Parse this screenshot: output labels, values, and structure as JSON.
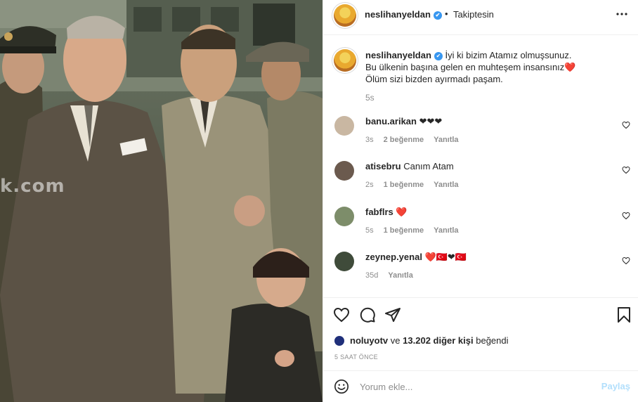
{
  "post": {
    "author": "neslihanyeldan",
    "verified_mark": "✔",
    "follow_separator": "•",
    "follow_status": "Takiptesin",
    "caption": {
      "username": "neslihanyeldan",
      "line1": "İyi ki bizim Atamız olmuşsunuz.",
      "line2": "Bu ülkenin başına gelen en muhteşem insansınız❤️",
      "line3": "Ölüm sizi bizden ayırmadı paşam.",
      "age": "5s"
    },
    "photo_watermark": "k.com",
    "comments": [
      {
        "username": "banu.arikan",
        "text": "❤❤❤",
        "age": "3s",
        "likes": "2 beğenme",
        "reply": "Yanıtla",
        "avatar_color": "#c9b7a2"
      },
      {
        "username": "atisebru",
        "text": "Canım Atam",
        "age": "2s",
        "likes": "1 beğenme",
        "reply": "Yanıtla",
        "avatar_color": "#6b5a4e"
      },
      {
        "username": "fabflrs",
        "text": "❤️",
        "age": "5s",
        "likes": "1 beğenme",
        "reply": "Yanıtla",
        "avatar_color": "#7d8d6a"
      },
      {
        "username": "zeynep.yenal",
        "text": "❤️🇹🇷❤🇹🇷",
        "age": "35d",
        "likes": "",
        "reply": "Yanıtla",
        "avatar_color": "#3f4b3a"
      }
    ],
    "liked_by": {
      "user": "noluyotv",
      "connector": "ve",
      "others": "13.202 diğer kişi",
      "suffix": "beğendi"
    },
    "timestamp": "5 SAAT ÖNCE",
    "comment_box": {
      "placeholder": "Yorum ekle...",
      "post_label": "Paylaş"
    },
    "icons": {
      "more": "more-options-icon",
      "like": "heart-icon",
      "comment": "comment-icon",
      "share": "share-icon",
      "save": "bookmark-icon",
      "emoji": "emoji-icon"
    },
    "colors": {
      "text": "#262626",
      "secondary": "#8e8e8e",
      "verified": "#3897f0",
      "post_button_disabled": "#b2dffc",
      "border": "#efefef"
    }
  }
}
